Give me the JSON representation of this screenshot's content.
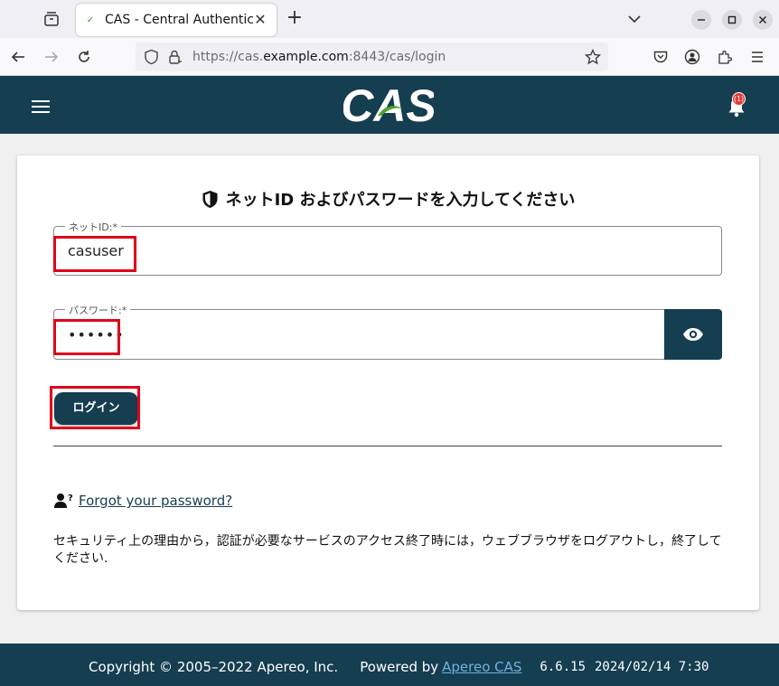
{
  "browser": {
    "tab_title": "CAS - Central Authenticat",
    "url_prefix": "https://cas.",
    "url_host": "example.com",
    "url_suffix": ":8443/cas/login"
  },
  "header": {
    "logo_text": "CAS",
    "notification_count": "(1)"
  },
  "login": {
    "title": "ネットID およびパスワードを入力してください",
    "username_label": "ネットID:*",
    "username_value": "casuser",
    "password_label": "パスワード:*",
    "password_value": "••••••",
    "submit_label": "ログイン",
    "forgot_link": "Forgot your password?",
    "notice": "セキュリティ上の理由から，認証が必要なサービスのアクセス終了時には，ウェブブラウザをログアウトし，終了してください."
  },
  "footer": {
    "copyright": "Copyright © 2005–2022 Apereo, Inc.",
    "powered_by": "Powered by",
    "powered_link": "Apereo CAS",
    "version": "6.6.15",
    "build_date": "2024/02/14 7:30"
  },
  "colors": {
    "brand": "#153e50",
    "highlight": "#e0001a"
  }
}
